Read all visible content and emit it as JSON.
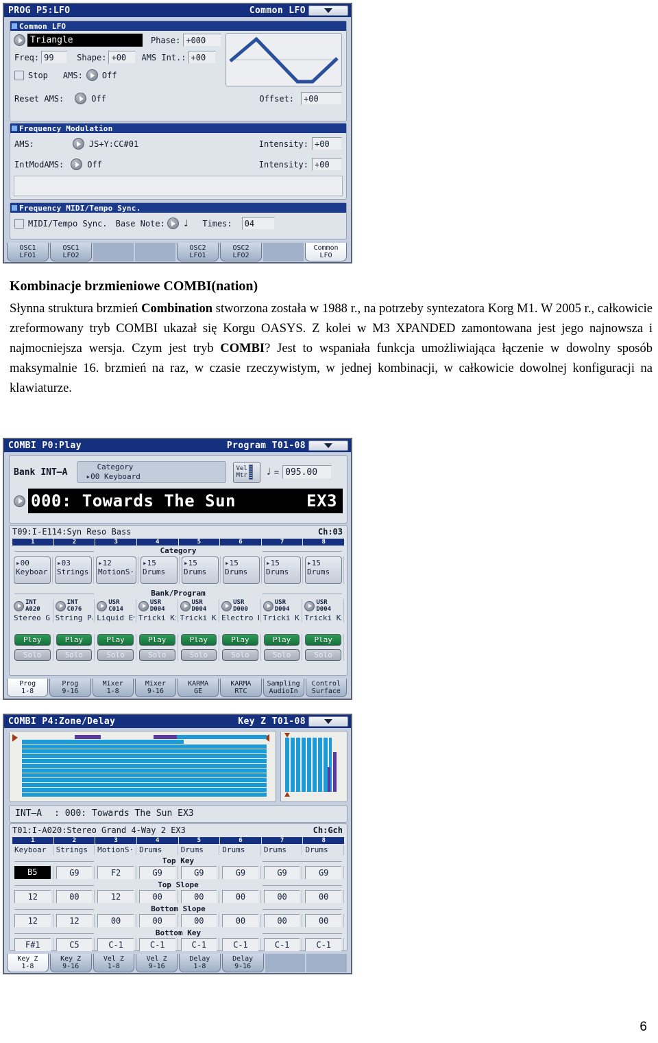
{
  "page": {
    "number": "6"
  },
  "lfo_screen": {
    "title_left": "PROG P5:LFO",
    "title_right": "Common LFO",
    "menu_icon": "chevron-down-icon",
    "group1": {
      "header": "Common LFO",
      "waveform": "Triangle",
      "phase_label": "Phase:",
      "phase_value": "+000",
      "freq_label": "Freq:",
      "freq_value": "99",
      "shape_label": "Shape:",
      "shape_value": "+00",
      "ams_int_label": "AMS Int.:",
      "ams_int_value": "+00",
      "stop_label": "Stop",
      "ams_label": "AMS:",
      "ams_value": "Off",
      "reset_ams_label": "Reset AMS:",
      "reset_ams_value": "Off",
      "offset_label": "Offset:",
      "offset_value": "+00"
    },
    "group2": {
      "header": "Frequency Modulation",
      "ams_label": "AMS:",
      "ams_value": "JS+Y:CC#01",
      "ams_intensity_label": "Intensity:",
      "ams_intensity_value": "+00",
      "intmodams_label": "IntModAMS:",
      "intmodams_value": "Off",
      "intmodams_intensity_label": "Intensity:",
      "intmodams_intensity_value": "+00"
    },
    "group3": {
      "header": "Frequency MIDI/Tempo Sync.",
      "sync_label": "MIDI/Tempo Sync.",
      "base_note_label": "Base Note:",
      "base_note_value": "♩",
      "times_label": "Times:",
      "times_value": "04"
    },
    "tabs": [
      {
        "l1": "OSC1",
        "l2": "LFO1",
        "active": false,
        "blank": false
      },
      {
        "l1": "OSC1",
        "l2": "LFO2",
        "active": false,
        "blank": false
      },
      {
        "l1": "",
        "l2": "",
        "active": false,
        "blank": true
      },
      {
        "l1": "",
        "l2": "",
        "active": false,
        "blank": true
      },
      {
        "l1": "OSC2",
        "l2": "LFO1",
        "active": false,
        "blank": false
      },
      {
        "l1": "OSC2",
        "l2": "LFO2",
        "active": false,
        "blank": false
      },
      {
        "l1": "",
        "l2": "",
        "active": false,
        "blank": true
      },
      {
        "l1": "Common",
        "l2": "LFO",
        "active": true,
        "blank": false
      }
    ]
  },
  "article": {
    "heading_plain": "Kombinacje brzmieniowe COMBI(nation)",
    "heading": {
      "a": "Kombinacje brzmieniowe COMBI(nation)"
    },
    "paragraph": {
      "p1": "Słynna struktura brzmień ",
      "b1": "Combination",
      "p2": " stworzona została w 1988 r., na potrzeby syntezatora Korg M1. W 2005 r., całkowicie zreformowany tryb COMBI ukazał się Korgu OASYS. Z kolei w M3 XPANDED zamontowana jest jego najnowsza i najmocniejsza wersja. Czym jest tryb ",
      "b2": "COMBI",
      "p3": "? Jest to wspaniała funkcja umożliwiająca łączenie w dowolny sposób maksymalnie 16. brzmień na raz, w czasie rzeczywistym, w jednej kombinacji, w całkowicie dowolnej konfiguracji na klawiaturze."
    }
  },
  "combi_play": {
    "title_left": "COMBI P0:Play",
    "title_right": "Program T01-08",
    "menu_icon": "chevron-down-icon",
    "bank_label": "Bank",
    "bank_value": "INT–A",
    "category_label": "Category",
    "category_value": "00 Keyboard",
    "velmtr_l1": "Vel",
    "velmtr_l2": "Mtr",
    "tempo_note": "♩",
    "tempo_eq": "=",
    "tempo_value": "095.00",
    "combi_name": "000: Towards The Sun",
    "combi_ex": "EX3",
    "timbre_info": "T09:I-E114:Syn Reso Bass",
    "channel_label": "Ch:03",
    "column_numbers": [
      "1",
      "2",
      "3",
      "4",
      "5",
      "6",
      "7",
      "8"
    ],
    "category_section": "Category",
    "bankprogram_section": "Bank/Program",
    "timbres": [
      {
        "cat_no": "00",
        "cat_name": "Keyboar",
        "bank": "INT",
        "prog": "A020",
        "prog_name": "Stereo G",
        "play": "Play",
        "solo": "Solo"
      },
      {
        "cat_no": "03",
        "cat_name": "Strings",
        "bank": "INT",
        "prog": "C076",
        "prog_name": "String Pa",
        "play": "Play",
        "solo": "Solo"
      },
      {
        "cat_no": "12",
        "cat_name": "MotionS·",
        "bank": "USR",
        "prog": "C014",
        "prog_name": "Liquid Ev",
        "play": "Play",
        "solo": "Solo"
      },
      {
        "cat_no": "15",
        "cat_name": "Drums",
        "bank": "USR",
        "prog": "D004",
        "prog_name": "Tricki Kit",
        "play": "Play",
        "solo": "Solo"
      },
      {
        "cat_no": "15",
        "cat_name": "Drums",
        "bank": "USR",
        "prog": "D004",
        "prog_name": "Tricki Kit",
        "play": "Play",
        "solo": "Solo"
      },
      {
        "cat_no": "15",
        "cat_name": "Drums",
        "bank": "USR",
        "prog": "D000",
        "prog_name": "Electro R",
        "play": "Play",
        "solo": "Solo"
      },
      {
        "cat_no": "15",
        "cat_name": "Drums",
        "bank": "USR",
        "prog": "D004",
        "prog_name": "Tricki Kit",
        "play": "Play",
        "solo": "Solo"
      },
      {
        "cat_no": "15",
        "cat_name": "Drums",
        "bank": "USR",
        "prog": "D004",
        "prog_name": "Tricki Kit",
        "play": "Play",
        "solo": "Solo"
      }
    ],
    "tabs": [
      {
        "l1": "Prog",
        "l2": "1-8",
        "active": true
      },
      {
        "l1": "Prog",
        "l2": "9-16",
        "active": false
      },
      {
        "l1": "Mixer",
        "l2": "1-8",
        "active": false
      },
      {
        "l1": "Mixer",
        "l2": "9-16",
        "active": false
      },
      {
        "l1": "KARMA",
        "l2": "GE",
        "active": false
      },
      {
        "l1": "KARMA",
        "l2": "RTC",
        "active": false
      },
      {
        "l1": "Sampling",
        "l2": "AudioIn",
        "active": false
      },
      {
        "l1": "Control",
        "l2": "Surface",
        "active": false
      }
    ]
  },
  "combi_zone": {
    "title_left": "COMBI P4:Zone/Delay",
    "title_right": "Key Z T01-08",
    "menu_icon": "chevron-down-icon",
    "bank_line_bank": "INT–A",
    "bank_line_name": ": 000: Towards The Sun     EX3",
    "timbre_info": "T01:I-A020:Stereo Grand 4-Way 2 EX3",
    "channel_label": "Ch:Gch",
    "column_numbers": [
      "1",
      "2",
      "3",
      "4",
      "5",
      "6",
      "7",
      "8"
    ],
    "categories": [
      "Keyboar",
      "Strings",
      "MotionS·",
      "Drums",
      "Drums",
      "Drums",
      "Drums",
      "Drums"
    ],
    "sections": {
      "top_key": "Top Key",
      "top_slope": "Top Slope",
      "bottom_slope": "Bottom Slope",
      "bottom_key": "Bottom Key"
    },
    "top_key": [
      "B5",
      "G9",
      "F2",
      "G9",
      "G9",
      "G9",
      "G9",
      "G9"
    ],
    "top_slope": [
      "12",
      "00",
      "12",
      "00",
      "00",
      "00",
      "00",
      "00"
    ],
    "bottom_slope": [
      "12",
      "12",
      "00",
      "00",
      "00",
      "00",
      "00",
      "00"
    ],
    "bottom_key": [
      "F#1",
      "C5",
      "C-1",
      "C-1",
      "C-1",
      "C-1",
      "C-1",
      "C-1"
    ],
    "tabs": [
      {
        "l1": "Key Z",
        "l2": "1-8",
        "active": true,
        "blank": false
      },
      {
        "l1": "Key Z",
        "l2": "9-16",
        "active": false,
        "blank": false
      },
      {
        "l1": "Vel Z",
        "l2": "1-8",
        "active": false,
        "blank": false
      },
      {
        "l1": "Vel Z",
        "l2": "9-16",
        "active": false,
        "blank": false
      },
      {
        "l1": "Delay",
        "l2": "1-8",
        "active": false,
        "blank": false
      },
      {
        "l1": "Delay",
        "l2": "9-16",
        "active": false,
        "blank": false
      },
      {
        "l1": "",
        "l2": "",
        "active": false,
        "blank": true
      },
      {
        "l1": "",
        "l2": "",
        "active": false,
        "blank": true
      }
    ]
  },
  "colors": {
    "titlebar": "#15307e",
    "group_header": "#1b3a8c",
    "panel_bg": "#c6cfe0",
    "group_bg": "#dfe3ea",
    "play_green": "#1d7c40",
    "zone_blue": "#1e9ad6",
    "zone_purple": "#5a3a9e",
    "waveform_line": "#2a4f9b"
  }
}
